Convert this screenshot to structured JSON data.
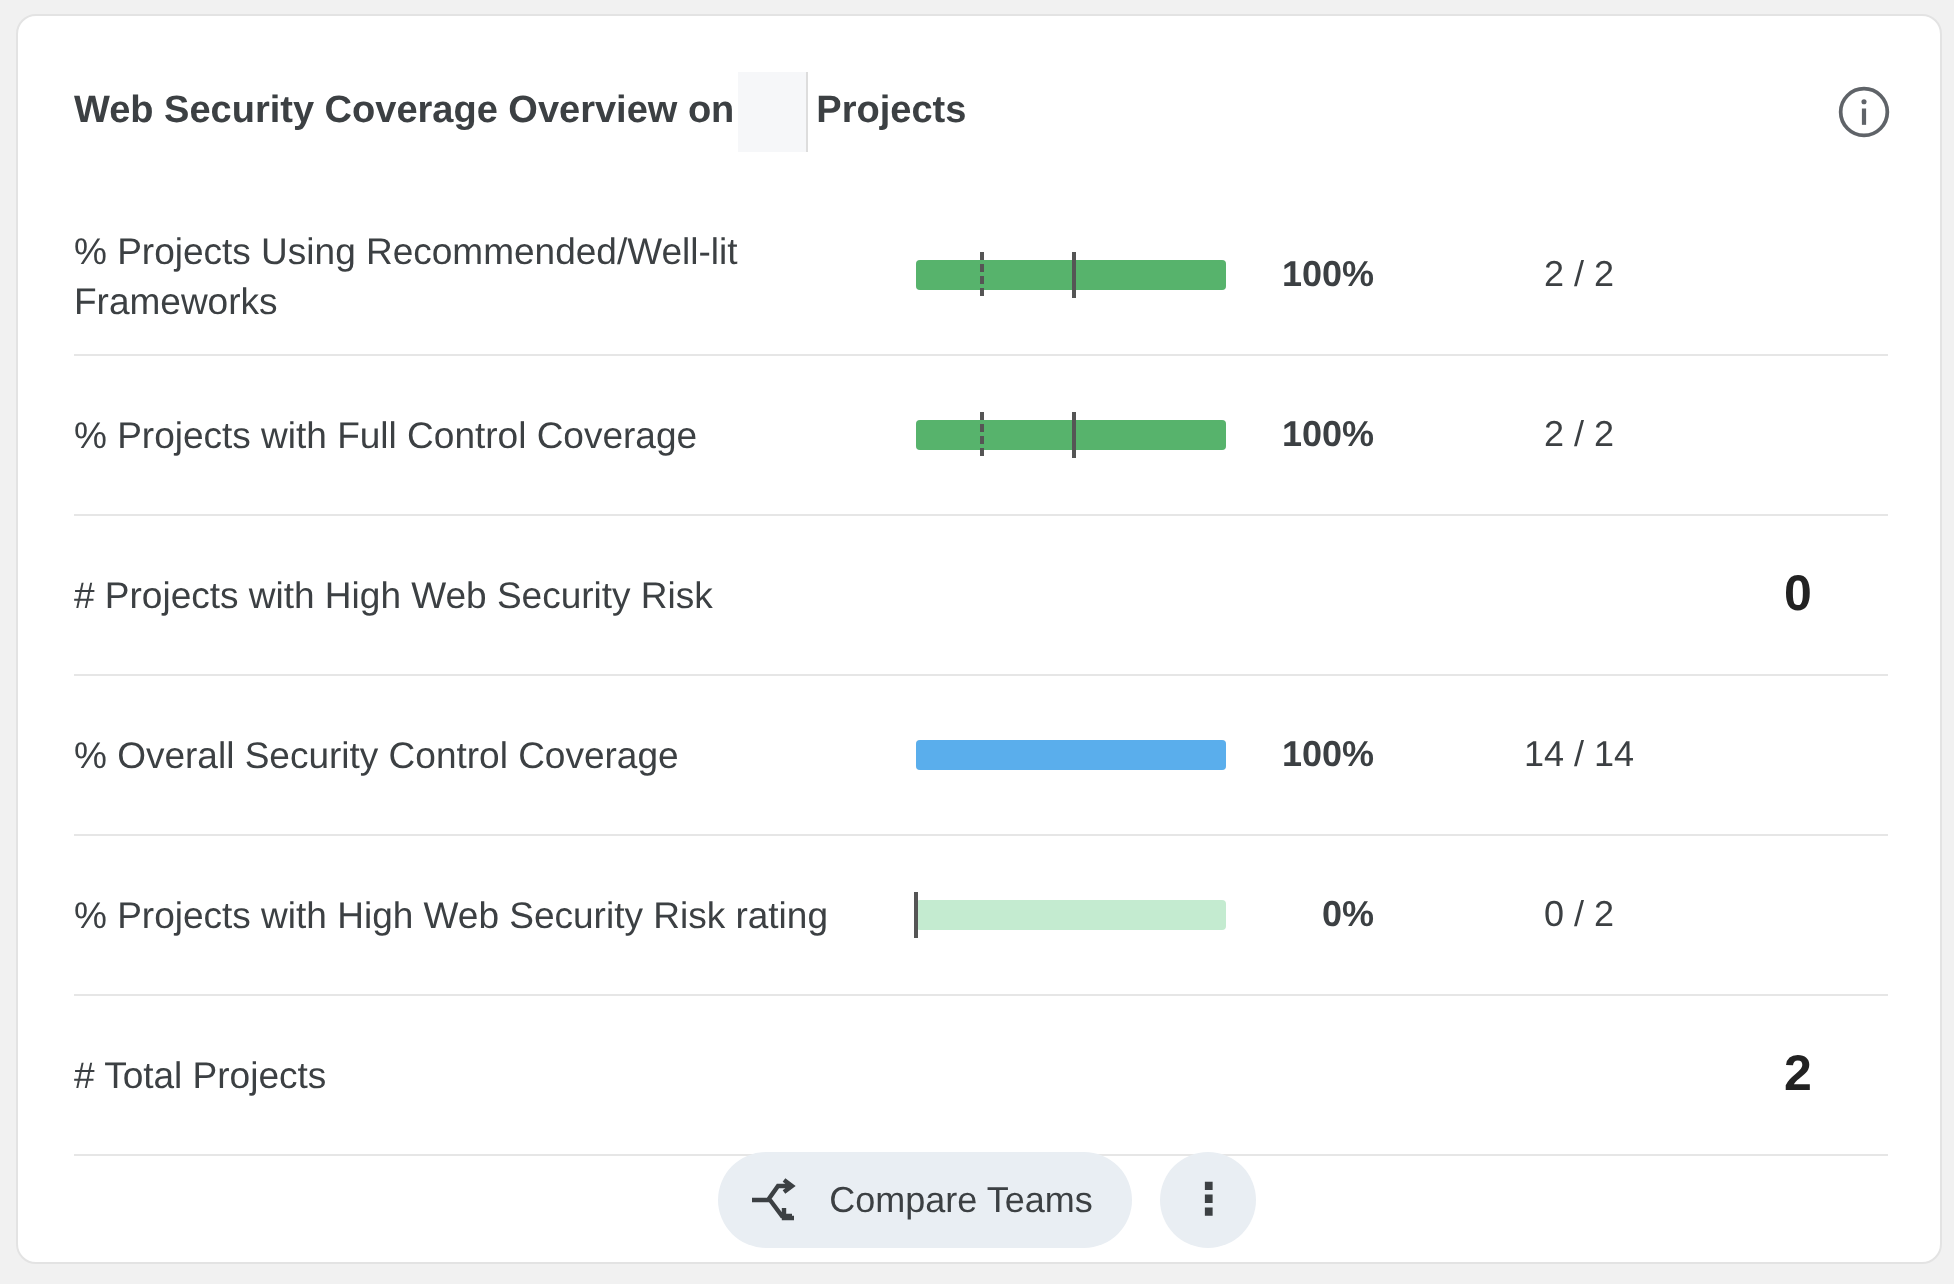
{
  "card": {
    "title_before": "Web Security Coverage Overview on",
    "title_redacted": true,
    "title_after": "Projects"
  },
  "rows": [
    {
      "kind": "bar",
      "label": "% Projects Using Recommended/Well-lit Frameworks",
      "level": 1,
      "color": "#57b36c",
      "percent": "100%",
      "fraction": "2 / 2",
      "markers": [
        {
          "kind": "dashed",
          "level": 0.21
        },
        {
          "kind": "solid",
          "level": 0.51
        }
      ]
    },
    {
      "kind": "bar",
      "label": "% Projects with Full Control Coverage",
      "level": 1,
      "color": "#57b36c",
      "percent": "100%",
      "fraction": "2 / 2",
      "markers": [
        {
          "kind": "dashed",
          "level": 0.21
        },
        {
          "kind": "solid",
          "level": 0.51
        }
      ]
    },
    {
      "kind": "count",
      "label": "# Projects with High Web Security Risk",
      "value": "0"
    },
    {
      "kind": "bar",
      "label": "% Overall Security Control Coverage",
      "level": 1,
      "color": "#5aaeec",
      "percent": "100%",
      "fraction": "14 / 14",
      "markers": []
    },
    {
      "kind": "bar",
      "label": "% Projects with High Web Security Risk rating",
      "level": 0,
      "color": "#c4ebd0",
      "percent": "0%",
      "fraction": "0 / 2",
      "markers": [
        {
          "kind": "solid",
          "level": 0
        }
      ]
    },
    {
      "kind": "count",
      "label": "# Total Projects",
      "value": "2"
    }
  ],
  "actions": {
    "compare": "Compare Teams",
    "more": "⋮"
  }
}
